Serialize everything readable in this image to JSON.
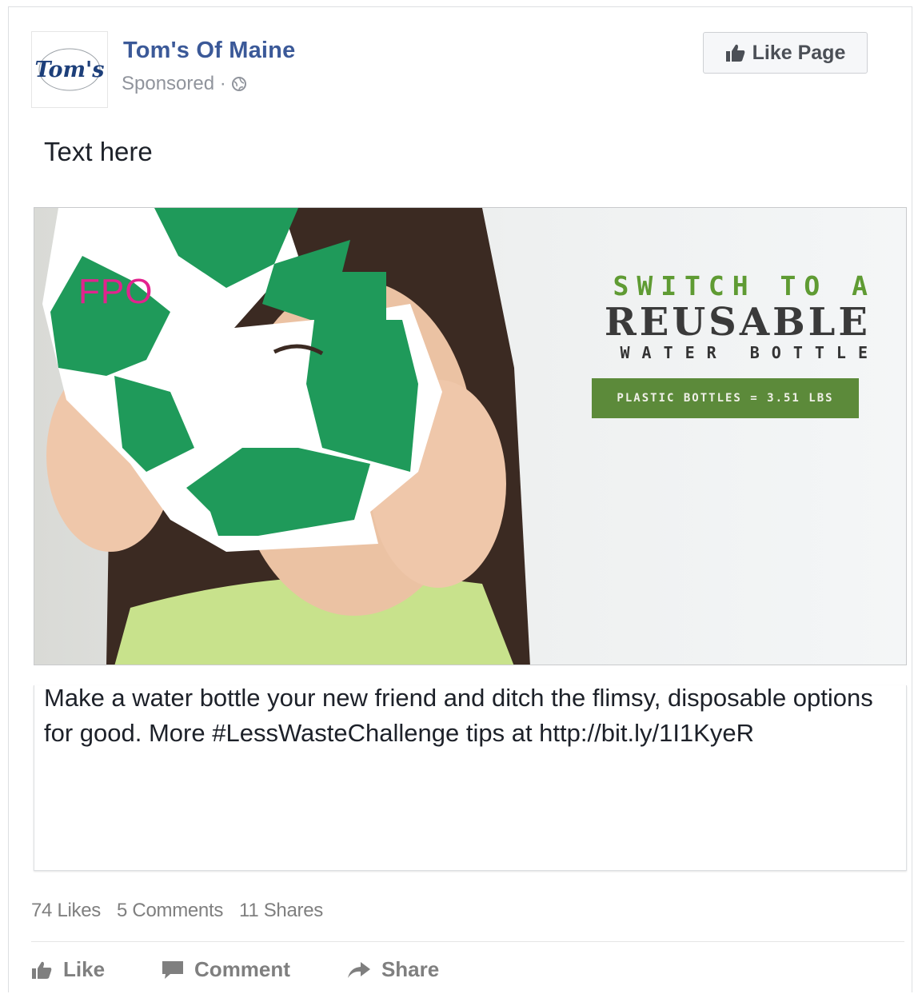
{
  "header": {
    "page_name": "Tom's Of Maine",
    "sponsored": "Sponsored ·",
    "globe_icon": "globe-icon",
    "like_page": "Like Page"
  },
  "logo": {
    "text": "Tom's"
  },
  "post_text": "Text here",
  "media": {
    "fpo": "FPO",
    "headline_1": "SWITCH TO A",
    "headline_2": "REUSABLE",
    "headline_3": "WATER BOTTLE",
    "stat": "PLASTIC BOTTLES = 3.51 LBS",
    "colors": {
      "recycle_green": "#1f9a5a",
      "headline_green": "#5f9b33",
      "badge": "#5c8a3a",
      "fpo": "#e2238e"
    }
  },
  "caption": "Make a water bottle your new friend and ditch the flimsy, disposable options for good. More #LessWasteChallenge tips at http://bit.ly/1I1KyeR",
  "counts": {
    "likes": "74 Likes",
    "comments": "5 Comments",
    "shares": "11 Shares"
  },
  "actions": {
    "like": "Like",
    "comment": "Comment",
    "share": "Share"
  },
  "brand_color": "#3b5998"
}
